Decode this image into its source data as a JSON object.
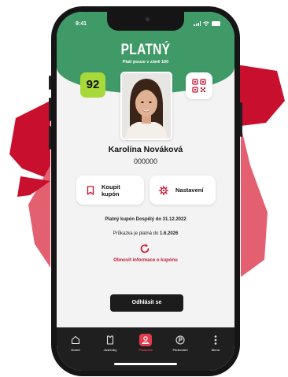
{
  "colors": {
    "brand_green": "#3f9a67",
    "badge_green": "#a8d93a",
    "accent_red": "#c01d33",
    "shape_red": "#c8102e",
    "shape_pink": "#e36070",
    "tab_bar": "#1f1f1f"
  },
  "status_bar": {
    "time": "9:41"
  },
  "header": {
    "title": "PLATNÝ",
    "subtitle": "Platí pouze v zóně 100"
  },
  "badge": {
    "value": "92"
  },
  "qr": {
    "icon": "qr-code-icon"
  },
  "user": {
    "name": "Karolína Nováková",
    "id": "000000"
  },
  "actions": {
    "buy": {
      "label_line1": "Koupit",
      "label_line2": "kupón",
      "icon": "bookmark-icon"
    },
    "settings": {
      "label": "Nastavení",
      "icon": "gear-icon"
    }
  },
  "coupon": {
    "line_text": "Platný kupón Dospělý do 31.12.2022",
    "card_text_prefix": "Průkazka je platná do",
    "card_valid_until": "1.6.2026",
    "refresh_label": "Obnovit informace o kupónu"
  },
  "logout_label": "Odhlásit se",
  "tabs": [
    {
      "label": "Domů",
      "icon": "home-icon",
      "active": false
    },
    {
      "label": "Jízdenky",
      "icon": "ticket-icon",
      "active": false
    },
    {
      "label": "Průkazka",
      "icon": "profile-card-icon",
      "active": true
    },
    {
      "label": "Parkování",
      "icon": "parking-icon",
      "active": false
    },
    {
      "label": "Menu",
      "icon": "more-vertical-icon",
      "active": false
    }
  ]
}
